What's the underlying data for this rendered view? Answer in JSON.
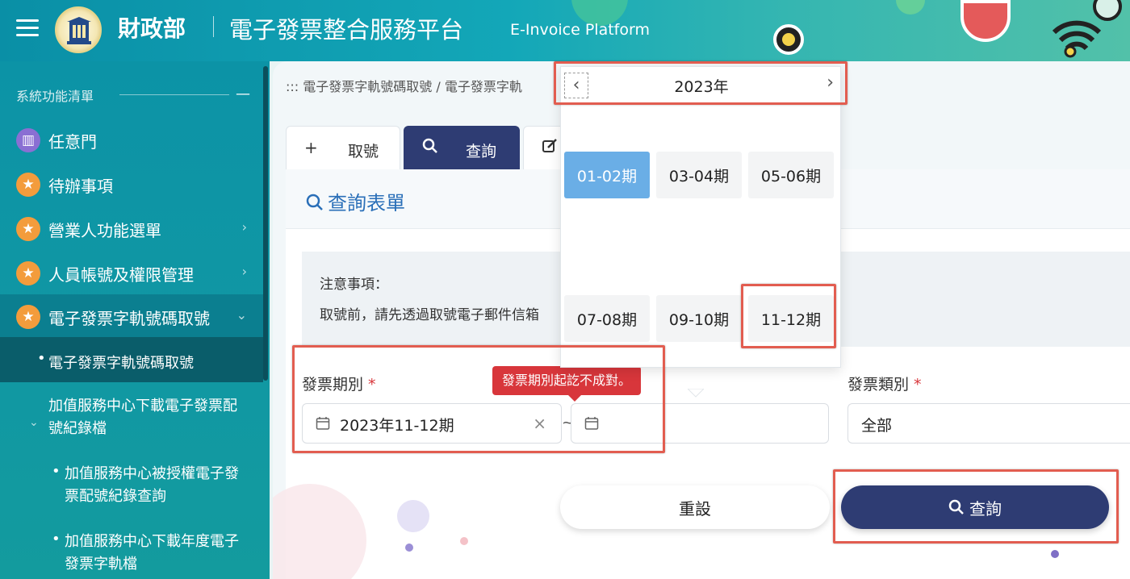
{
  "header": {
    "ministry": "財政部",
    "platform_zh": "電子發票整合服務平台",
    "platform_en": "E-Invoice Platform"
  },
  "sidebar": {
    "title": "系統功能清單",
    "collapse": "—",
    "items": [
      {
        "label": "任意門",
        "icon": "map-icon"
      },
      {
        "label": "待辦事項",
        "icon": "star-icon"
      },
      {
        "label": "營業人功能選單",
        "icon": "star-icon",
        "chevron": "›"
      },
      {
        "label": "人員帳號及權限管理",
        "icon": "star-icon",
        "chevron": "›"
      },
      {
        "label": "電子發票字軌號碼取號",
        "icon": "star-icon",
        "chevron": "⌄"
      }
    ],
    "active_sub": "電子發票字軌號碼取號",
    "group": "加值服務中心下載電子發票配號紀錄檔",
    "group_chevron": "⌄",
    "sub_items": [
      "加值服務中心被授權電子發票配號紀錄查詢",
      "加值服務中心下載年度電子發票字軌檔"
    ]
  },
  "breadcrumb": "::: 電子發票字軌號碼取號 / 電子發票字軌",
  "tabs": [
    {
      "label": "取號",
      "icon": "+"
    },
    {
      "label": "查詢",
      "icon": "search-icon"
    },
    {
      "label": "",
      "icon": "edit-icon"
    }
  ],
  "panel": {
    "title": "查詢表單",
    "notice_title": "注意事項：",
    "notice_text": "取號前，請先透過取號電子郵件信箱"
  },
  "form": {
    "period_label": "發票期別",
    "required_mark": "*",
    "period_start": "2023年11-12期",
    "clear": "×",
    "range_sep": "~",
    "type_label": "發票類別",
    "type_value": "全部",
    "error": "發票期別起訖不成對。"
  },
  "buttons": {
    "reset": "重設",
    "search": "查詢"
  },
  "picker": {
    "year": "2023年",
    "prev": "‹",
    "next": "›",
    "periods": [
      "01-02期",
      "03-04期",
      "05-06期",
      "07-08期",
      "09-10期",
      "11-12期"
    ],
    "selected": "01-02期"
  },
  "colors": {
    "accent": "#2e3c73",
    "selected": "#6aaee6",
    "error": "#d8363b",
    "highlight": "#e25d50"
  }
}
